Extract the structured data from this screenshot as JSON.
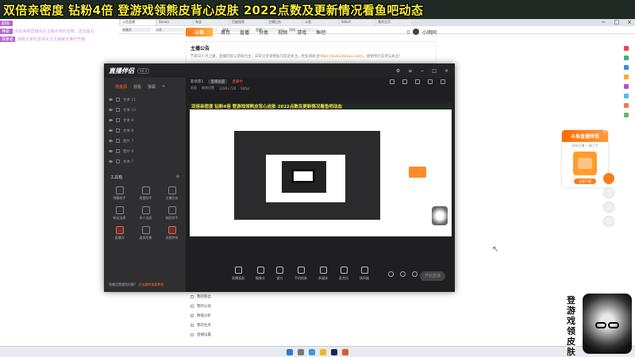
{
  "banner": {
    "text": "双倍亲密度 钻粉4倍  登游戏领熊皮背心皮肤 2022点数及更新情况看鱼吧动态"
  },
  "chat": [
    {
      "who": "超级·",
      "text": ""
    },
    {
      "who": "神豪·",
      "text": "欢迎来到直播间为主播点亮粉丝牌，送出鱼丸"
    },
    {
      "who": "探索者",
      "text": "感谢大家的支持关注主播每天准时开播"
    }
  ],
  "browser": {
    "tabs": [
      "斗鱼直播",
      "Steam",
      "淘宝",
      "百度搜索",
      "主播后台",
      "斗鱼",
      "Bilibili",
      "我的主页"
    ],
    "bookmarks": [
      "收藏夹",
      "斗鱼",
      "Steam",
      "游戏",
      "直播",
      "资料"
    ]
  },
  "douyu": {
    "logo": "斗鱼",
    "nav": [
      "首页",
      "直播",
      "分类",
      "视频",
      "游戏",
      "鱼吧"
    ],
    "user": "小明同",
    "notice_title": "主播公告",
    "notice_body": "节目日十点上播，直播内容以游戏为主，日常分享攻略技巧欢迎关注。更多请关注",
    "notice_link": "https://yuba.douyu.com/",
    "notice_tail": "，感谢你的支持与关注！",
    "menu": [
      "我的粉丝",
      "我的公会",
      "数据分析",
      "我的任务",
      "直播设置"
    ]
  },
  "obs": {
    "logo": "直播伴侣",
    "version": "V6.3",
    "side_tabs": [
      "场景源",
      "观看",
      "弹幕"
    ],
    "sources": [
      "文本 11",
      "文本 10",
      "文本 9",
      "文本 8",
      "图片 7",
      "图片 6",
      "文本 7"
    ],
    "tools_label": "工具箱",
    "tools": [
      "弹幕助手",
      "房管助手",
      "主播任务",
      "粉丝连麦",
      "多人连麦",
      "抽奖助手",
      "直播间",
      "虚拟形象",
      "滤镜特效"
    ],
    "foot_tip": "直播设置遇到问题？",
    "foot_link": "点击跳转查看教程",
    "scene_label": "新场景1",
    "scene_name": "直播画面",
    "scene_red": "直播中",
    "scene_row2": [
      "画面",
      "缩放设置",
      "1280×720",
      "60fps"
    ],
    "toolbar": [
      "直播画面",
      "摄像头",
      "窗口",
      "手机投屏",
      "多媒体",
      "麦克风",
      "扬声器"
    ],
    "live_btn": "开始直播"
  },
  "preview": {
    "banner": "双倍亲密度 钻粉4倍  登游戏领熊皮背心皮肤 2022点数及更新情况看鱼吧动态"
  },
  "promo": {
    "head": "斗鱼直播伴侣",
    "sub": "高效开播 一键上手",
    "btn": "立即下载"
  },
  "overlay_art": {
    "text": "登游戏领皮肤"
  }
}
